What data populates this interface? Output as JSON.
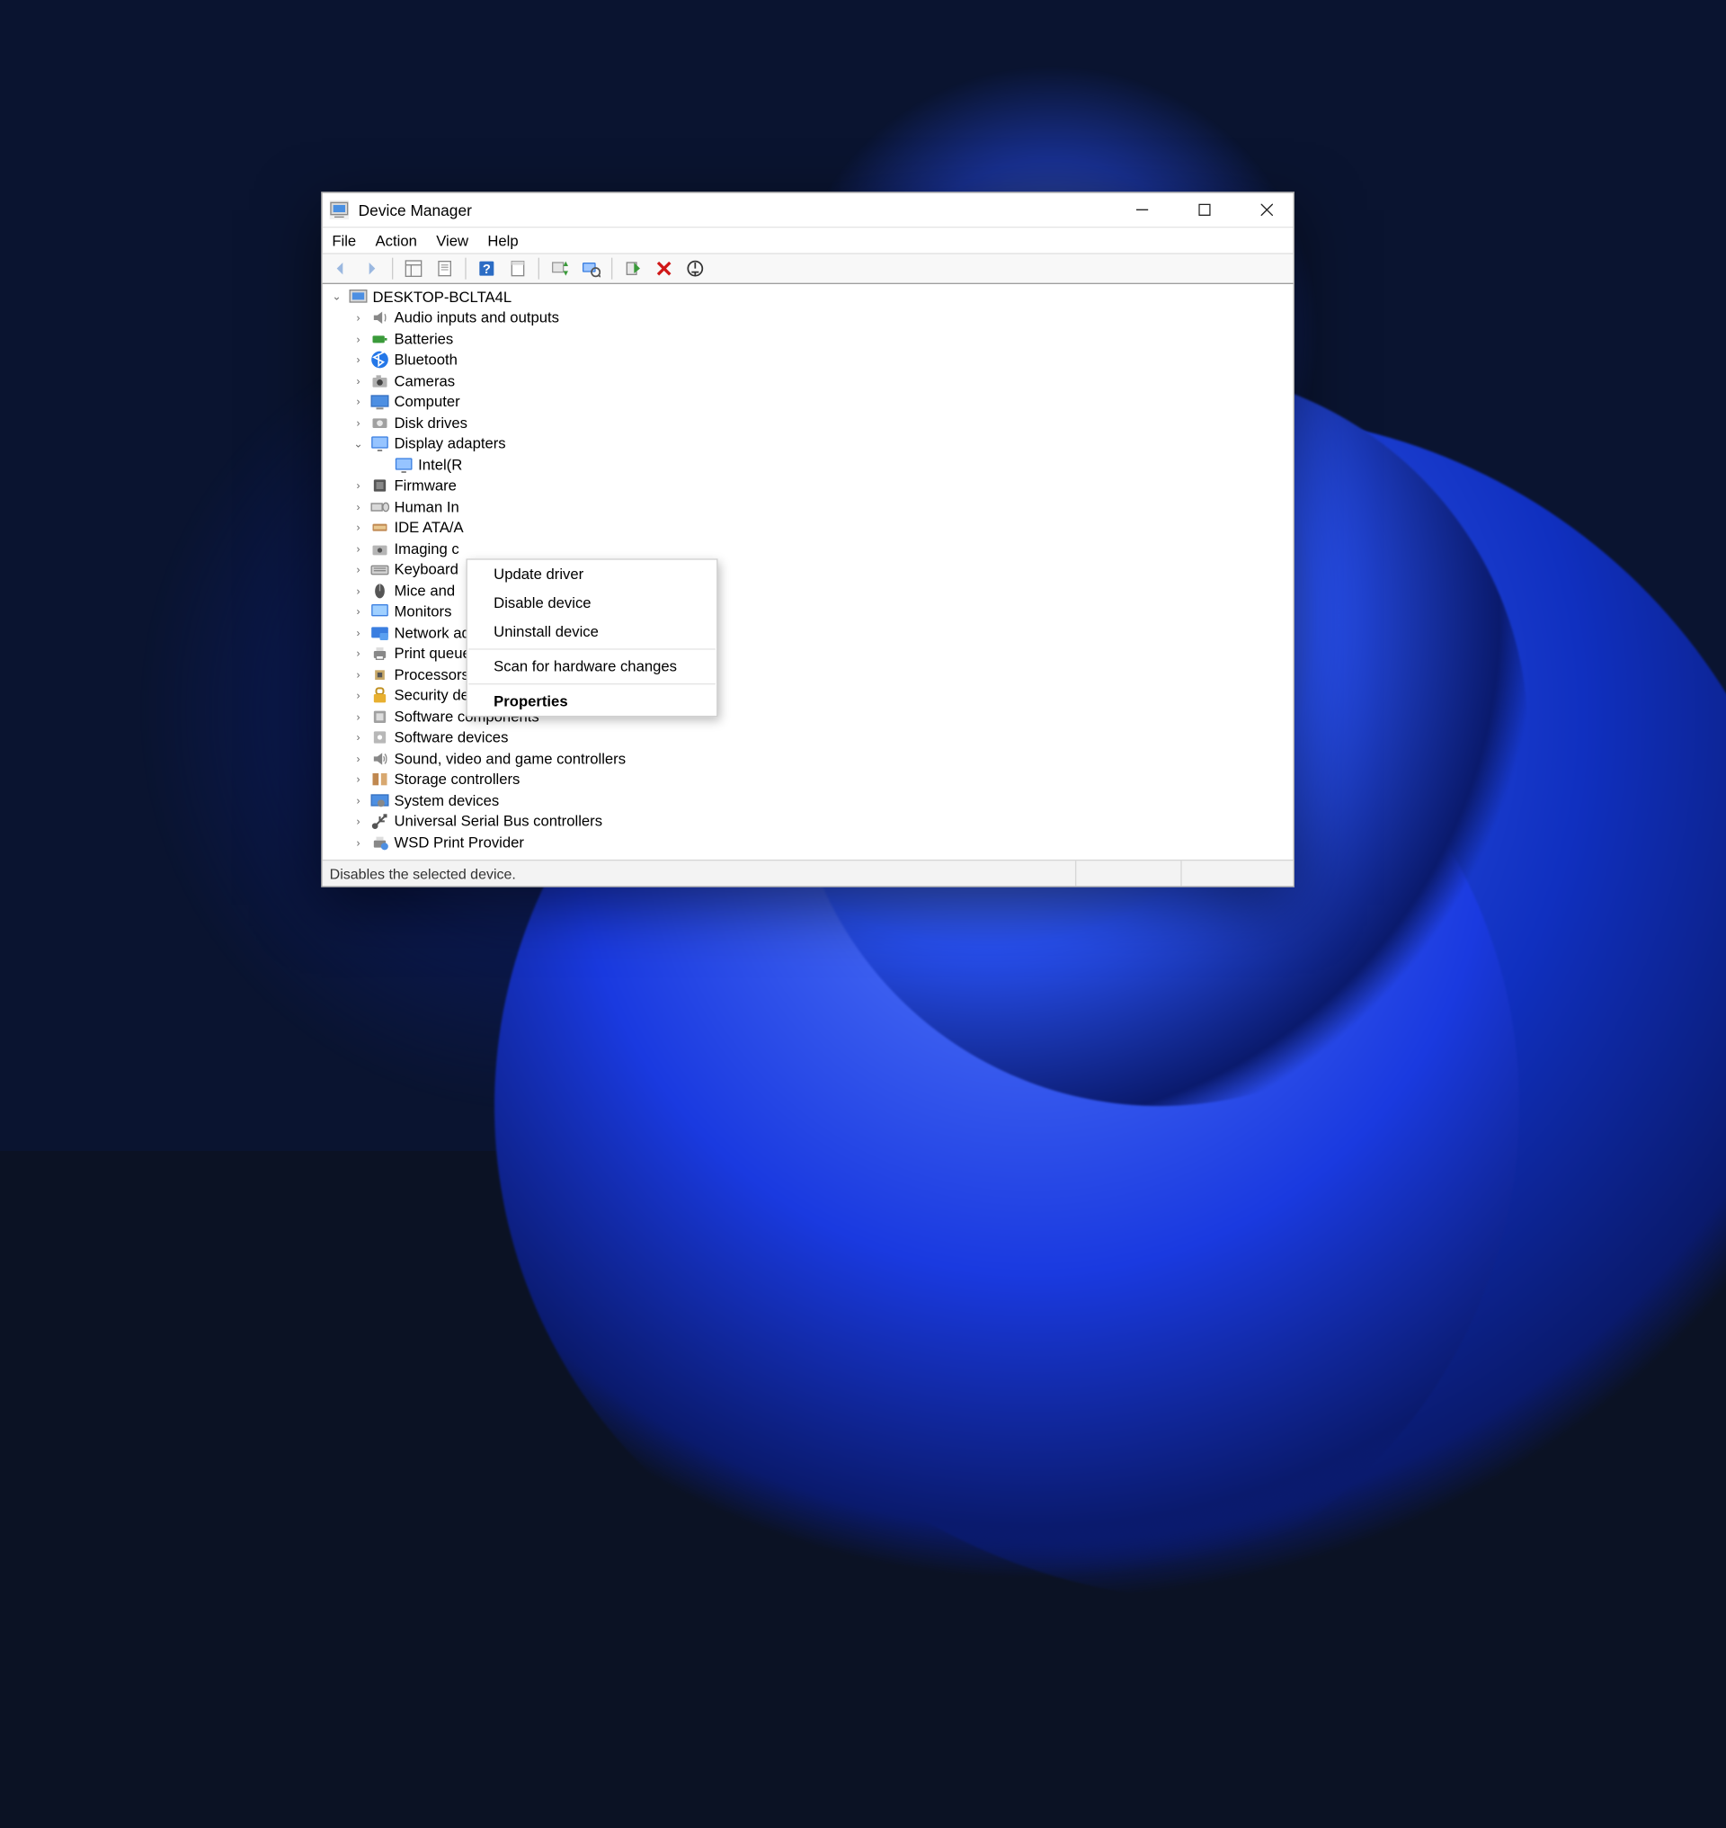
{
  "window": {
    "title": "Device Manager"
  },
  "menubar": {
    "file": "File",
    "action": "Action",
    "view": "View",
    "help": "Help"
  },
  "tree": {
    "root": "DESKTOP-BCLTA4L",
    "items": [
      "Audio inputs and outputs",
      "Batteries",
      "Bluetooth",
      "Cameras",
      "Computer",
      "Disk drives",
      "Display adapters",
      "Firmware",
      "Human In",
      "IDE ATA/A",
      "Imaging c",
      "Keyboard",
      "Mice and",
      "Monitors",
      "Network adapters",
      "Print queues",
      "Processors",
      "Security devices",
      "Software components",
      "Software devices",
      "Sound, video and game controllers",
      "Storage controllers",
      "System devices",
      "Universal Serial Bus controllers",
      "WSD Print Provider"
    ],
    "display_child": "Intel(R"
  },
  "context_menu": {
    "update": "Update driver",
    "disable": "Disable device",
    "uninstall": "Uninstall device",
    "scan": "Scan for hardware changes",
    "properties": "Properties"
  },
  "status": "Disables the selected device."
}
